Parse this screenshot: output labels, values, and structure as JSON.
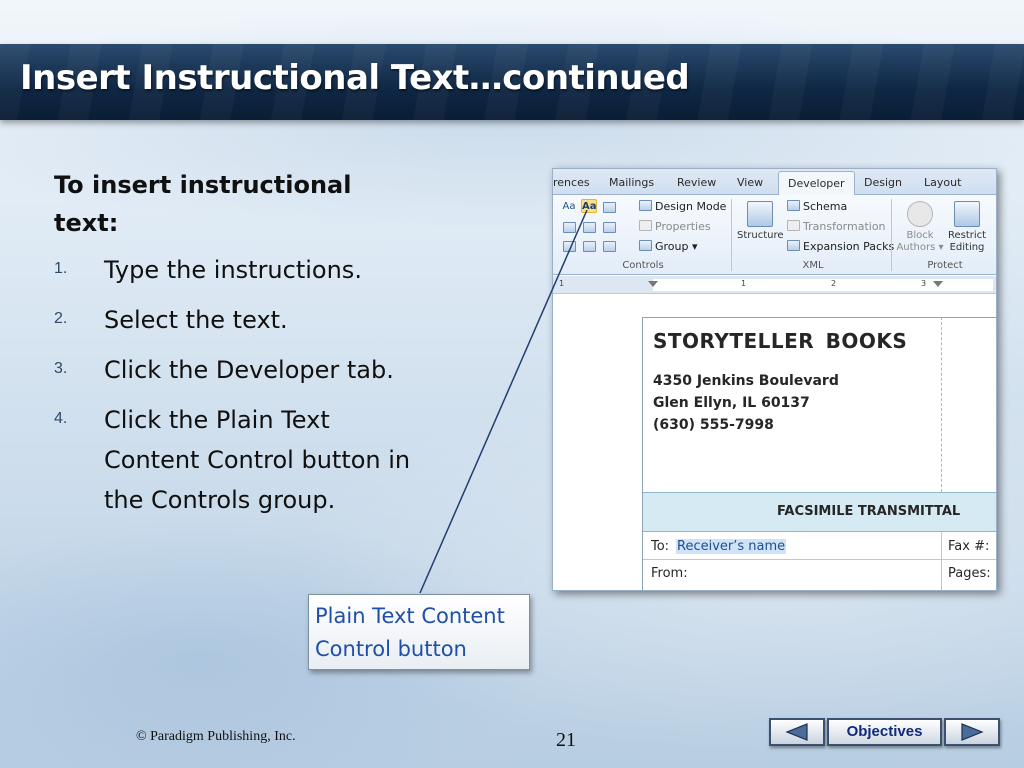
{
  "slide": {
    "title": "Insert Instructional Text…continued",
    "heading": "To insert instructional text:",
    "steps": [
      {
        "num": "1.",
        "text": "Type the instructions."
      },
      {
        "num": "2.",
        "text": "Select the text."
      },
      {
        "num": "3.",
        "text": "Click the Developer tab."
      },
      {
        "num": "4.",
        "text": "Click the Plain Text Content Control button in the Controls group."
      }
    ],
    "callout": "Plain Text Content Control button",
    "copyright": "© Paradigm Publishing, Inc.",
    "page_number": "21",
    "nav": {
      "objectives_label": "Objectives"
    }
  },
  "word": {
    "tabs": [
      "rences",
      "Mailings",
      "Review",
      "View",
      "Developer",
      "Design",
      "Layout"
    ],
    "active_tab": "Developer",
    "controls": {
      "aa_plain": "Aa",
      "aa_rich": "Aa",
      "design_mode": "Design Mode",
      "properties": "Properties",
      "group": "Group ▾",
      "label": "Controls"
    },
    "xml": {
      "structure": "Structure",
      "schema": "Schema",
      "transformation": "Transformation",
      "expansion_packs": "Expansion Packs",
      "label": "XML"
    },
    "protect": {
      "block_authors_1": "Block",
      "block_authors_2": "Authors ▾",
      "restrict_editing_1": "Restrict",
      "restrict_editing_2": "Editing",
      "label": "Protect"
    },
    "ruler_numbers": [
      "1",
      "1",
      "2",
      "3"
    ],
    "document": {
      "company": "STORYTELLER  BOOKS",
      "address_lines": [
        "4350 Jenkins Boulevard",
        "Glen Ellyn, IL 60137",
        "(630) 555-7998"
      ],
      "fax_title": "FACSIMILE TRANSMITTAL",
      "to_label": "To:",
      "receiver_placeholder": "Receiver’s name",
      "fax_label": "Fax #:",
      "from_label": "From:",
      "pages_label": "Pages:"
    }
  }
}
